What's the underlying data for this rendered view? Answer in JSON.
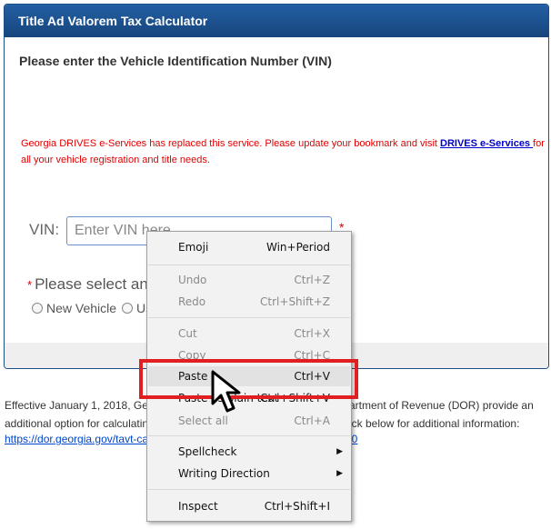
{
  "panel": {
    "title": "Title Ad Valorem Tax Calculator",
    "subtitle": "Please enter the Vehicle Identification Number (VIN)",
    "notice_prefix": "Georgia DRIVES e-Services has replaced this service.  Please update your bookmark and visit ",
    "notice_link": "DRIVES e-Services ",
    "notice_suffix": "for all your vehicle registration and title needs.",
    "vin_label": "VIN:",
    "vin_placeholder": "Enter VIN here",
    "required_mark": "*",
    "select_prompt": "Please select an",
    "radio_new": "New Vehicle",
    "radio_used": "Us"
  },
  "info": {
    "line1_start": "Effective January 1, 2018, Ge",
    "line1_end": "artment of Revenue (DOR) provide an",
    "line2_start": "additional option for calculatin",
    "line2_end": "ick below for additional information:",
    "link_start": "https://dor.georgia.gov/tavt-ca",
    "link_end": "7-0"
  },
  "context_menu": {
    "items": [
      {
        "label": "Emoji",
        "shortcut": "Win+Period"
      },
      {
        "label": "Undo",
        "shortcut": "Ctrl+Z"
      },
      {
        "label": "Redo",
        "shortcut": "Ctrl+Shift+Z"
      },
      {
        "label": "Cut",
        "shortcut": "Ctrl+X"
      },
      {
        "label": "Copy",
        "shortcut": "Ctrl+C"
      },
      {
        "label": "Paste",
        "shortcut": "Ctrl+V"
      },
      {
        "label": "Paste as plain text",
        "shortcut": "Ctrl+Shift+V"
      },
      {
        "label": "Select all",
        "shortcut": "Ctrl+A"
      },
      {
        "label": "Spellcheck",
        "shortcut": ""
      },
      {
        "label": "Writing Direction",
        "shortcut": ""
      },
      {
        "label": "Inspect",
        "shortcut": "Ctrl+Shift+I"
      }
    ],
    "highlight_color": "#e02020"
  },
  "icons": {
    "submenu": "chevron-right-icon",
    "pointer": "mouse-cursor-icon"
  }
}
